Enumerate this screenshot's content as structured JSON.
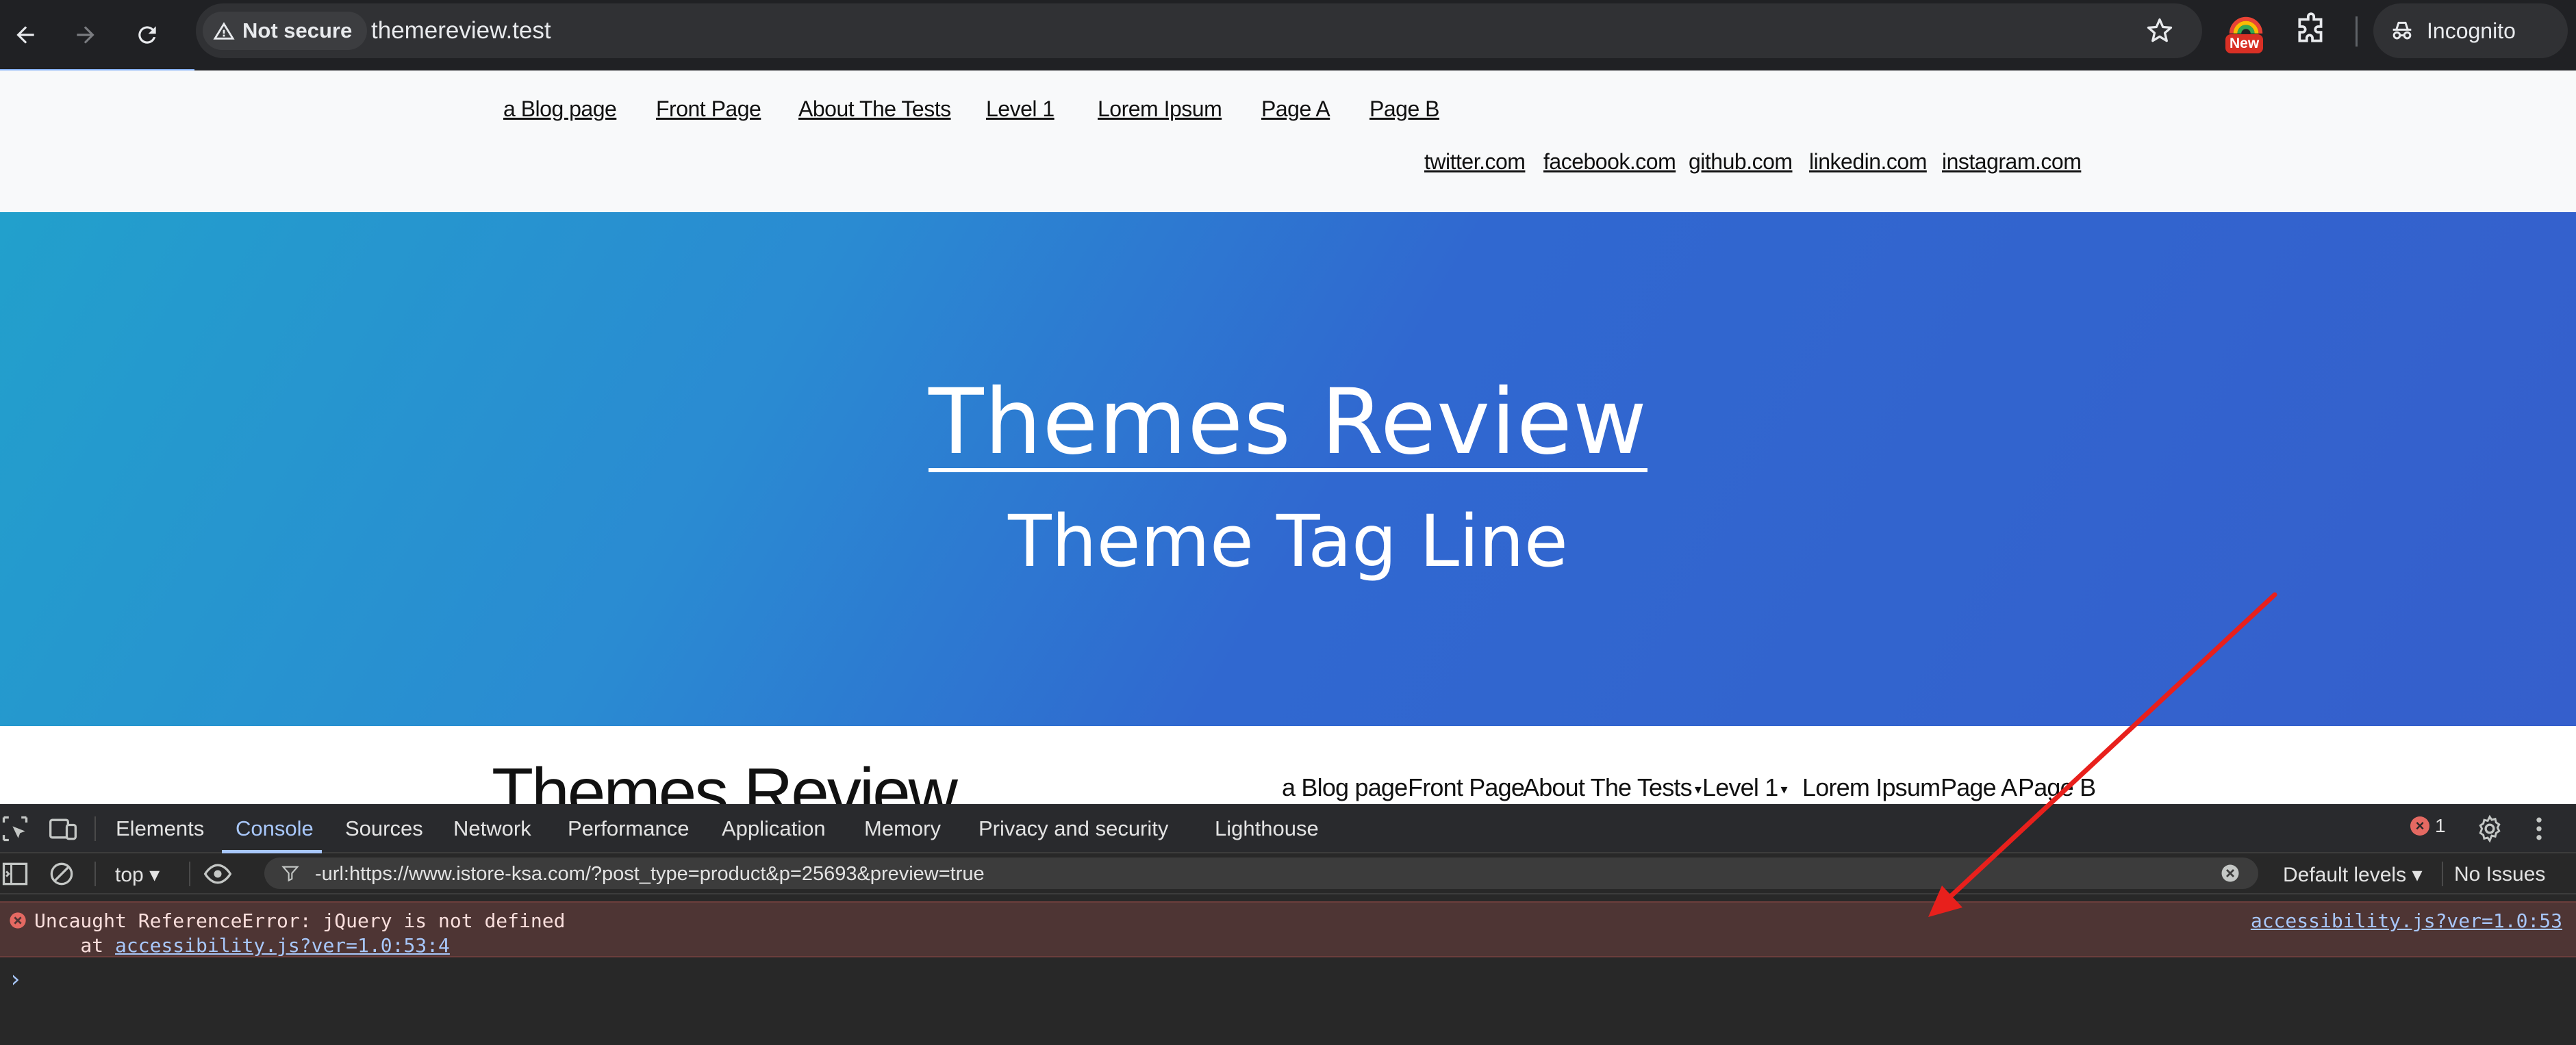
{
  "browser": {
    "security_label": "Not secure",
    "url": "themereview.test",
    "new_badge": "New",
    "incognito_label": "Incognito"
  },
  "site": {
    "primary_menu": [
      "a Blog page",
      "Front Page",
      "About The Tests",
      "Level 1",
      "Lorem Ipsum",
      "Page A",
      "Page B"
    ],
    "social_menu": [
      "twitter.com",
      "facebook.com",
      "github.com",
      "linkedin.com",
      "instagram.com"
    ],
    "hero_title": "Themes Review",
    "hero_tagline": "Theme Tag Line",
    "sticky_title": "Themes Review",
    "sticky_menu": [
      "a Blog page",
      "Front Page",
      "About The Tests",
      "Level 1",
      "Lorem Ipsum",
      "Page A",
      "Page B"
    ]
  },
  "devtools": {
    "tabs": [
      "Elements",
      "Console",
      "Sources",
      "Network",
      "Performance",
      "Application",
      "Memory",
      "Privacy and security",
      "Lighthouse"
    ],
    "active_tab": "Console",
    "error_count": "1",
    "context": "top",
    "filter": "-url:https://www.istore-ksa.com/?post_type=product&p=25693&preview=true",
    "levels": "Default levels",
    "issues": "No Issues",
    "error": {
      "message": "Uncaught ReferenceError: jQuery is not defined",
      "stack_prefix": "    at ",
      "stack_link": "accessibility.js?ver=1.0:53:4",
      "source": "accessibility.js?ver=1.0:53"
    },
    "prompt": "›"
  },
  "colors": {
    "hero_start": "#22a0cc",
    "hero_end": "#355fcc",
    "annotation_arrow": "#e8201c",
    "console_error_bg": "#4e3534",
    "active_tab": "#a8c7fa"
  }
}
